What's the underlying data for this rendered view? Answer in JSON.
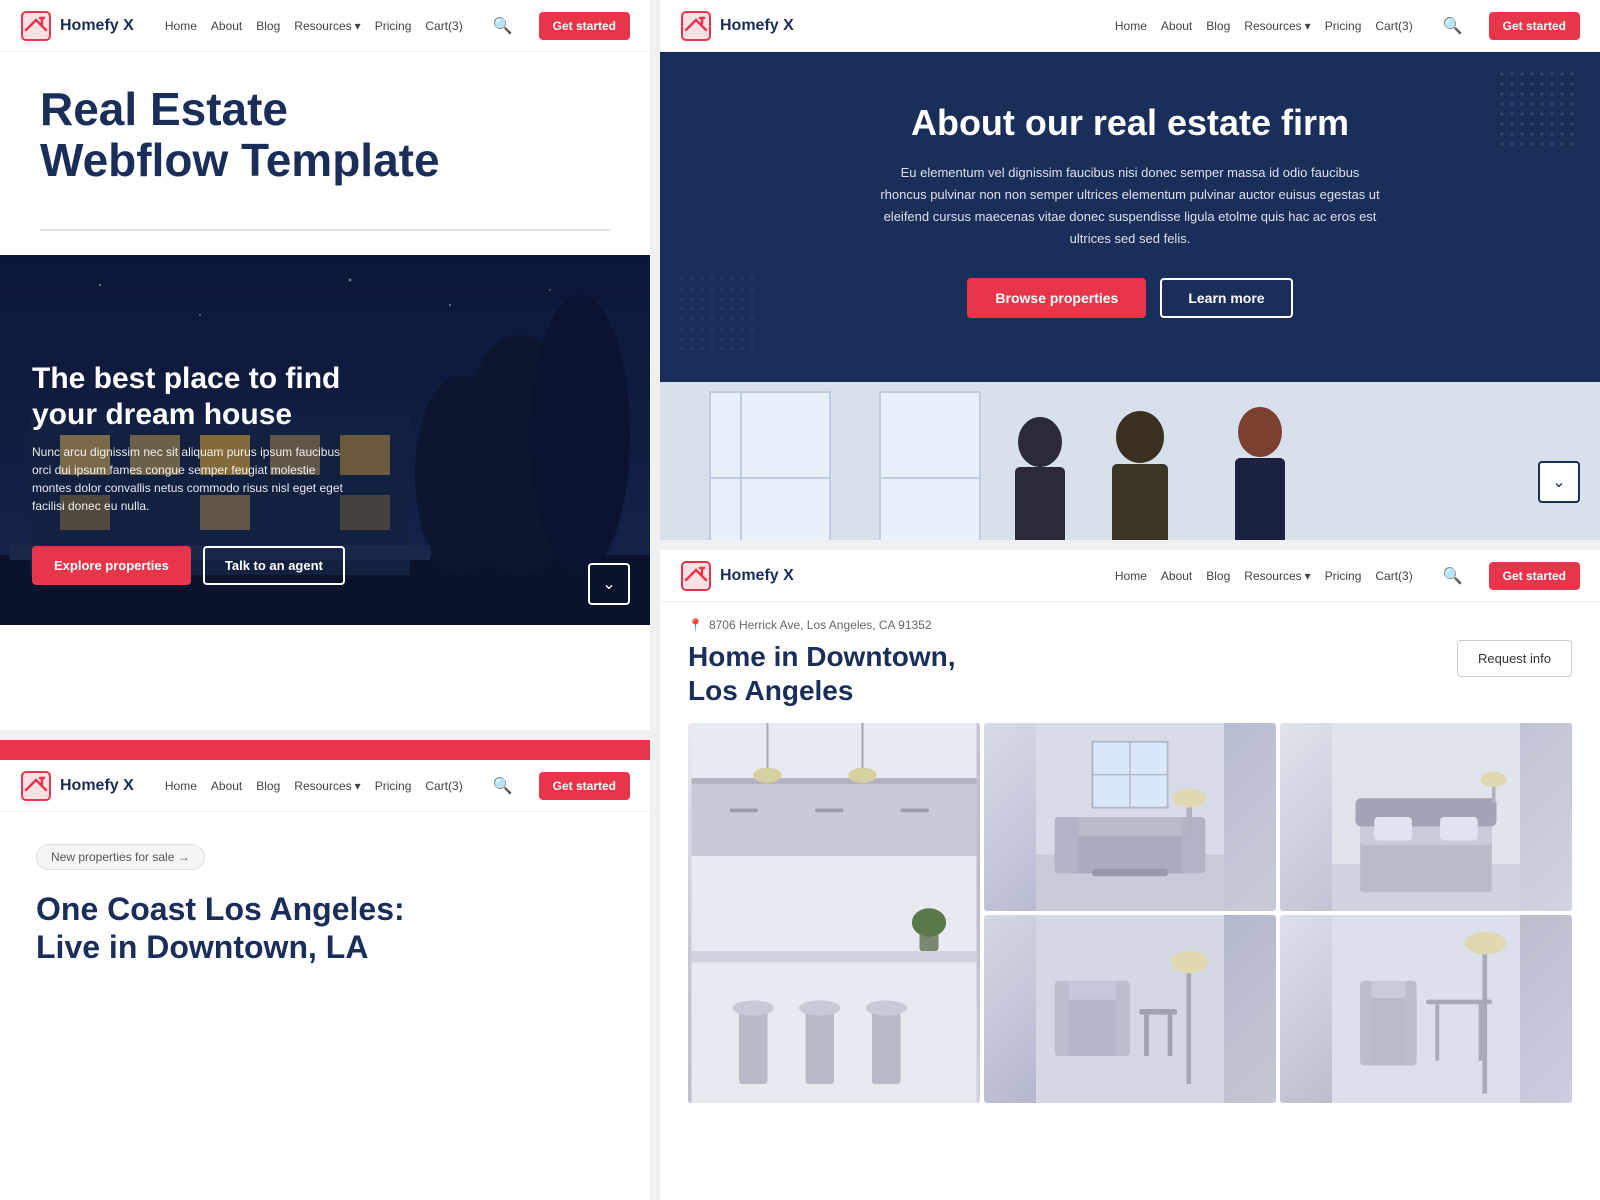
{
  "brand": {
    "name": "Homefy X",
    "logo_alt": "Homefy X logo"
  },
  "nav": {
    "home": "Home",
    "about": "About",
    "blog": "Blog",
    "resources": "Resources",
    "pricing": "Pricing",
    "cart": "Cart(3)",
    "get_started": "Get started"
  },
  "panel1": {
    "main_title_line1": "Real Estate",
    "main_title_line2": "Webflow Template",
    "hero_heading_line1": "The best place to find",
    "hero_heading_line2": "your dream house",
    "hero_body": "Nunc arcu dignissim nec sit aliquam purus ipsum faucibus orci dui ipsum fames congue semper feugiat molestie montes dolor convallis netus commodo risus nisl eget eget facilisi donec eu nulla.",
    "btn_explore": "Explore properties",
    "btn_agent": "Talk to an agent"
  },
  "panel2": {
    "about_title": "About our real estate firm",
    "about_desc": "Eu elementum vel dignissim faucibus nisi donec semper massa id odio faucibus rhoncus pulvinar non non semper ultrices elementum pulvinar auctor euisus egestas ut eleifend cursus maecenas vitae donec suspendisse ligula etolme quis hac ac eros est ultrices sed sed felis.",
    "btn_browse": "Browse properties",
    "btn_learn": "Learn more"
  },
  "panel3": {
    "new_tag": "New properties for sale →",
    "listing_title_line1": "One Coast Los Angeles:",
    "listing_title_line2": "Live in Downtown, LA",
    "nav_pricing": "Pricing",
    "nav_about": "About"
  },
  "panel4": {
    "address": "8706 Herrick Ave, Los Angeles, CA 91352",
    "title_line1": "Home in Downtown,",
    "title_line2": "Los Angeles",
    "btn_request": "Request info",
    "nav_pricing": "Pricing",
    "nav_about": "About"
  },
  "colors": {
    "navy": "#1a2e5a",
    "red": "#e8354a",
    "white": "#ffffff",
    "light_gray": "#f5f5f5"
  },
  "icons": {
    "search": "🔍",
    "chevron_down": "▾",
    "chevron_down_box": "⌄",
    "pin": "📍",
    "arrow_right": "→"
  }
}
